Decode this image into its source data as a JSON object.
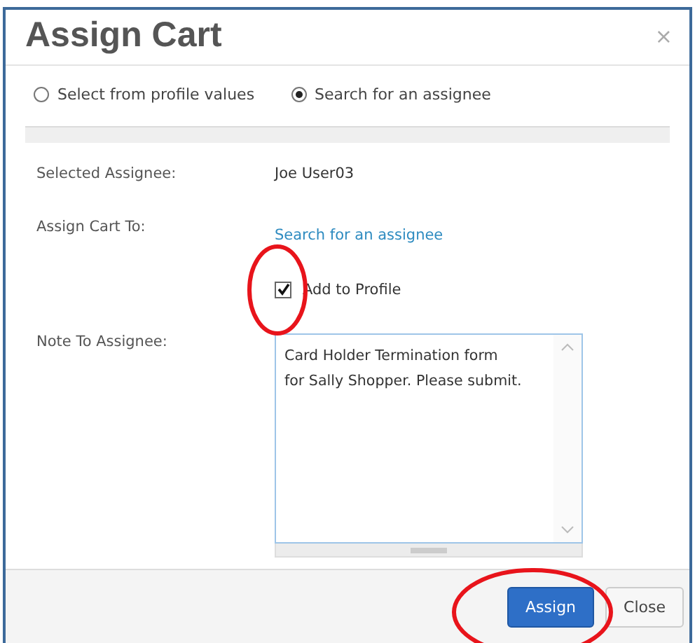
{
  "dialog": {
    "title": "Assign Cart",
    "close_icon": "×"
  },
  "source_options": [
    {
      "label": "Select from profile values",
      "selected": false
    },
    {
      "label": "Search for an assignee",
      "selected": true
    }
  ],
  "fields": [
    {
      "kind": "text",
      "label": "Selected Assignee:",
      "value": "Joe User03"
    },
    {
      "kind": "link",
      "label": "Assign Cart To:",
      "value": "Search for an assignee"
    },
    {
      "kind": "checkbox",
      "label": "Add to Profile",
      "checked": true
    },
    {
      "kind": "textarea",
      "label": "Note To Assignee:",
      "value": "Card Holder Termination form\nfor Sally Shopper. Please submit."
    }
  ],
  "buttons": [
    {
      "label": "Assign",
      "kind": "primary"
    },
    {
      "label": "Close",
      "kind": "secondary"
    }
  ]
}
